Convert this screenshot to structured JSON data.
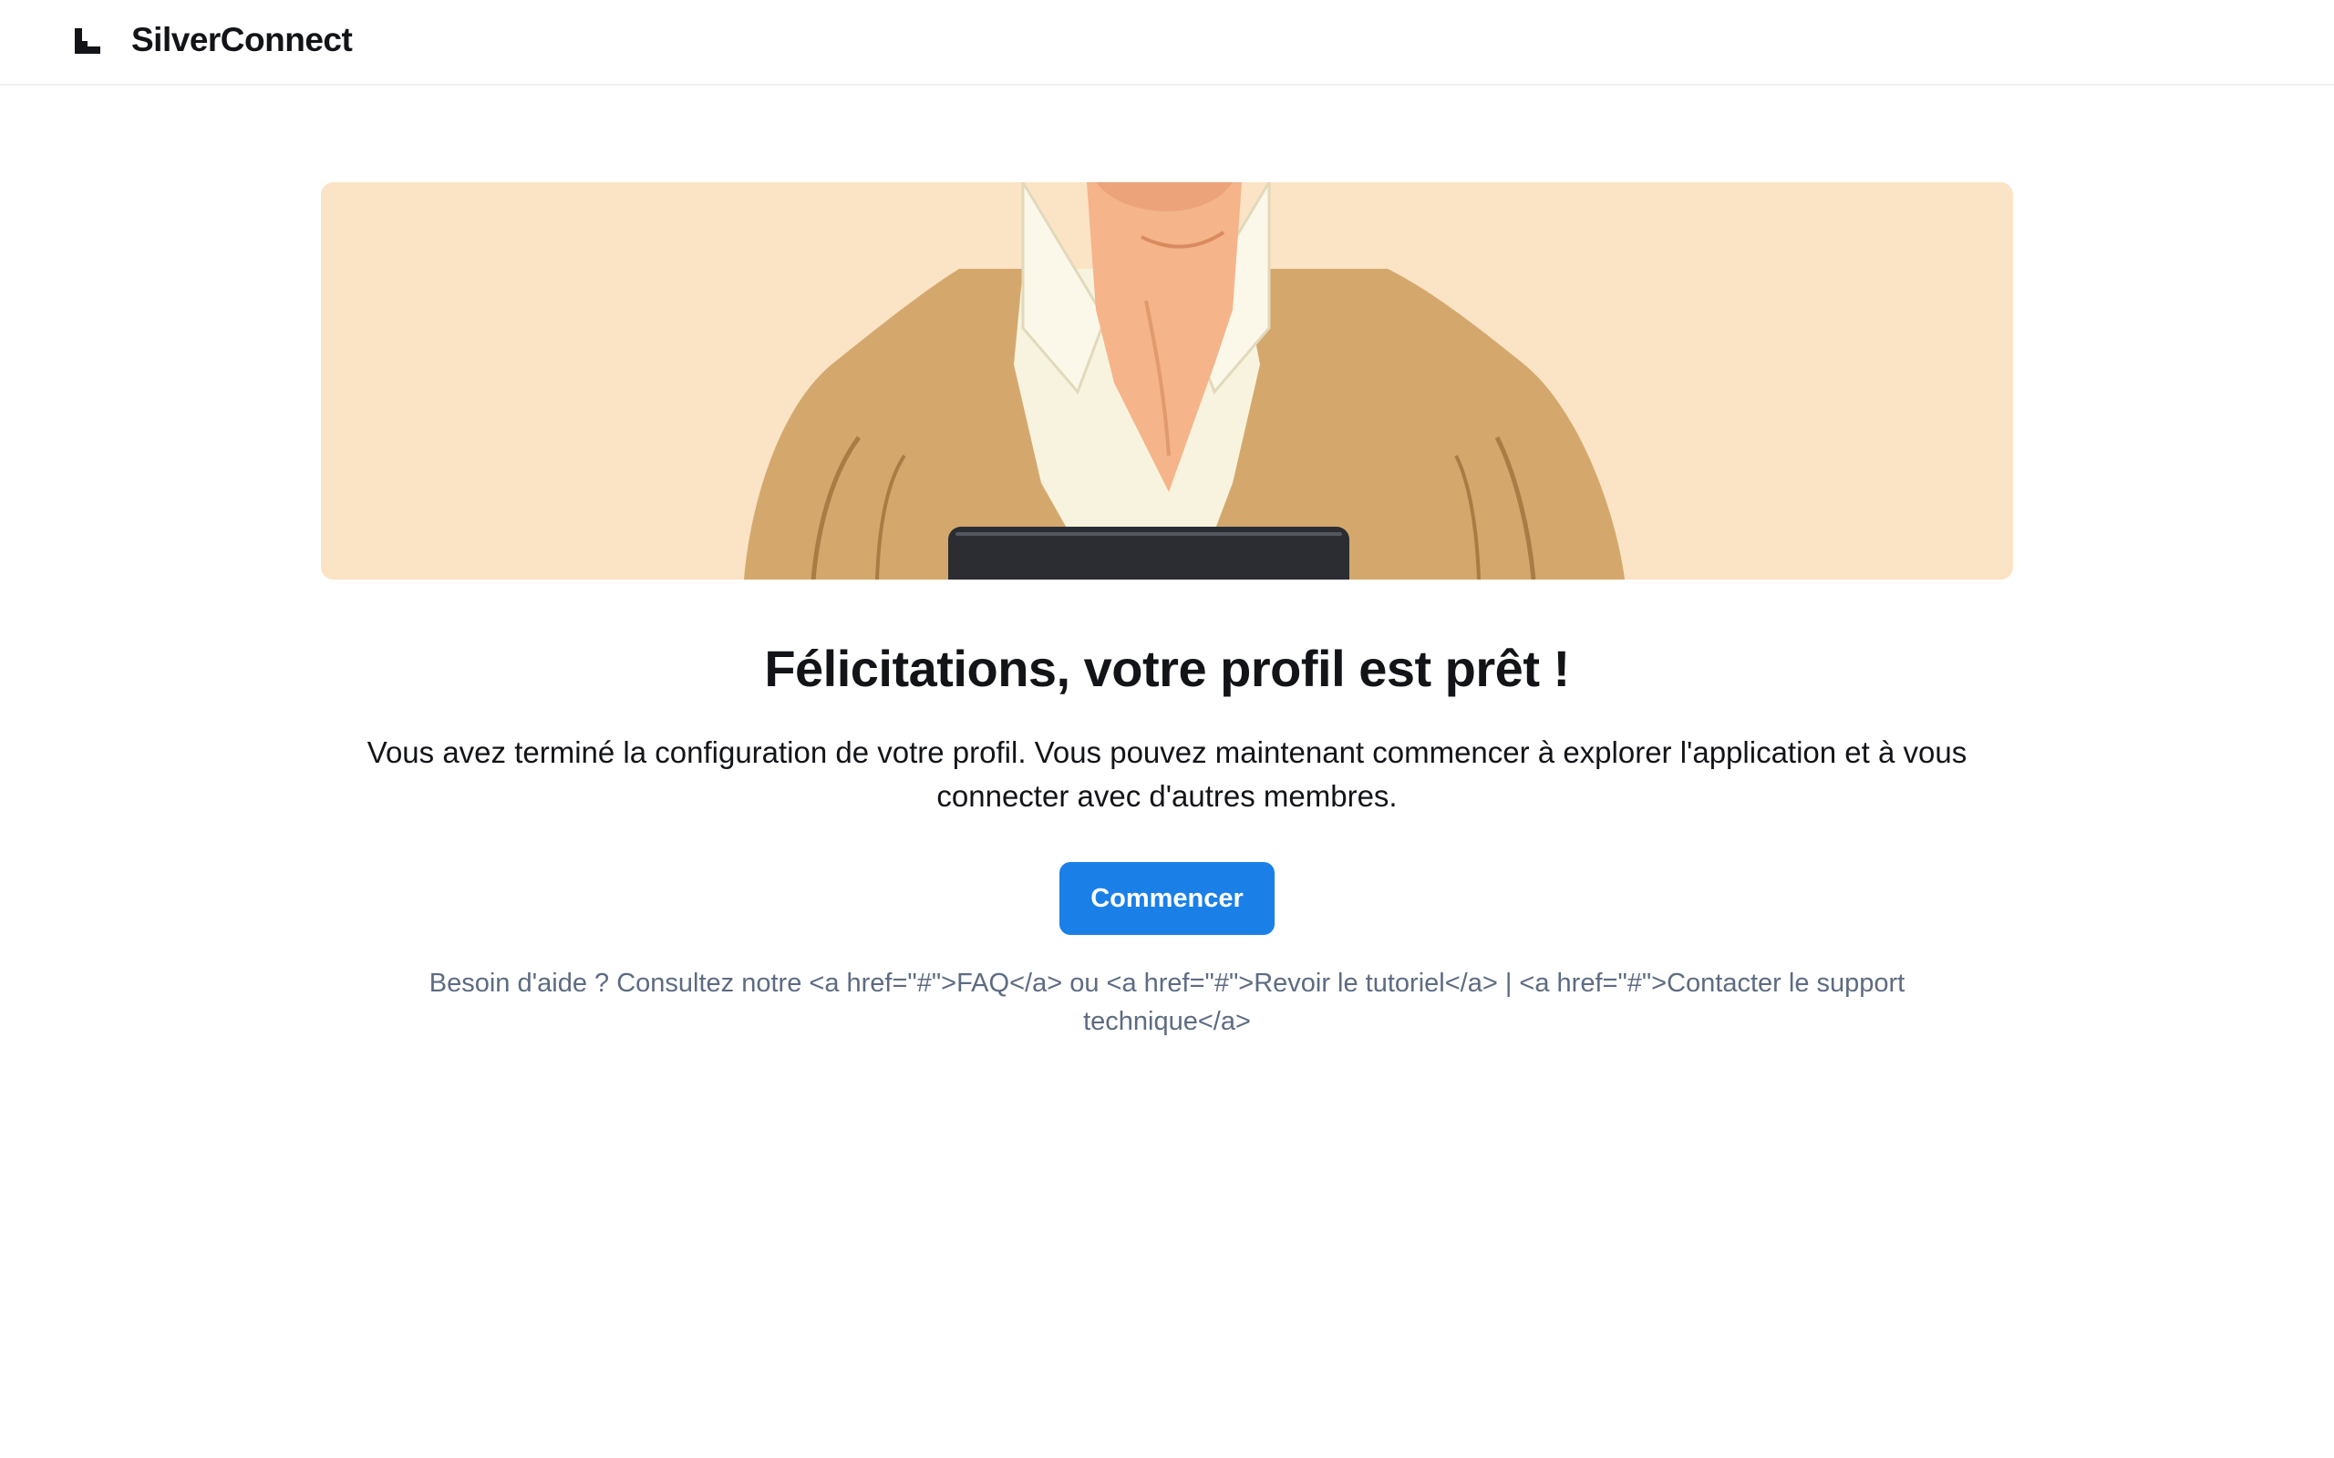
{
  "header": {
    "app_name": "SilverConnect",
    "logo_icon": "staircase-logo-icon"
  },
  "hero": {
    "image": "illustration-person-holding-tablet"
  },
  "main": {
    "title": "Félicitations, votre profil est prêt !",
    "description": "Vous avez terminé la configuration de votre profil. Vous pouvez maintenant commencer à explorer l'application et à vous connecter avec d'autres membres.",
    "start_button": "Commencer",
    "help_text": "Besoin d'aide ? Consultez notre <a href=\"#\">FAQ</a> ou <a href=\"#\">Revoir le tutoriel</a> | <a href=\"#\">Contacter le support technique</a>"
  },
  "colors": {
    "accent": "#1a80e8",
    "hero_background": "#fbe3c5",
    "muted_text": "#5d6b82"
  }
}
